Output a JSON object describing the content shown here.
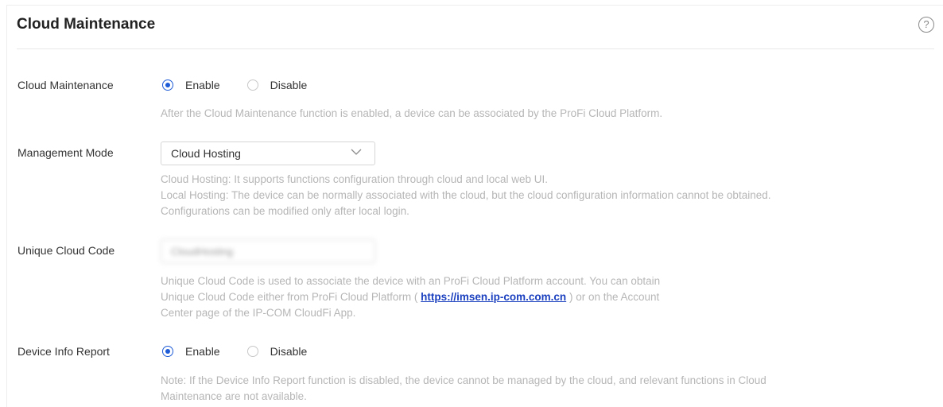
{
  "panel": {
    "title": "Cloud Maintenance",
    "help_icon": "?"
  },
  "cloud_maintenance": {
    "label": "Cloud Maintenance",
    "options": [
      "Enable",
      "Disable"
    ],
    "selected": "Enable",
    "hint": "After the Cloud Maintenance function is enabled, a device can be associated by the ProFi Cloud Platform."
  },
  "management_mode": {
    "label": "Management Mode",
    "value": "Cloud Hosting",
    "hint_lines": [
      "Cloud Hosting: It supports functions configuration through cloud and local web UI.",
      "Local Hosting: The device can be normally associated with the cloud, but the cloud configuration information cannot be obtained.",
      "Configurations can be modified only after local login."
    ]
  },
  "unique_cloud_code": {
    "label": "Unique Cloud Code",
    "value": "CloudHosting",
    "hint_line1": "Unique Cloud Code is used to associate the device with an ProFi Cloud Platform account. You can obtain",
    "hint_line2_before": "Unique Cloud Code either from ProFi Cloud Platform (",
    "hint_link": "https://imsen.ip-com.com.cn",
    "hint_line2_after": ") or on the Account",
    "hint_line3": "Center page of the IP-COM CloudFi App."
  },
  "device_info_report": {
    "label": "Device Info Report",
    "options": [
      "Enable",
      "Disable"
    ],
    "selected": "Enable",
    "hint_lines": [
      "Note: If the Device Info Report function is disabled, the device cannot be managed by the cloud, and relevant functions in Cloud",
      "Maintenance are not available."
    ]
  },
  "colors": {
    "accent": "#1e5bd6",
    "hint_text": "#b6b6b6",
    "link": "#1a3fbf"
  }
}
